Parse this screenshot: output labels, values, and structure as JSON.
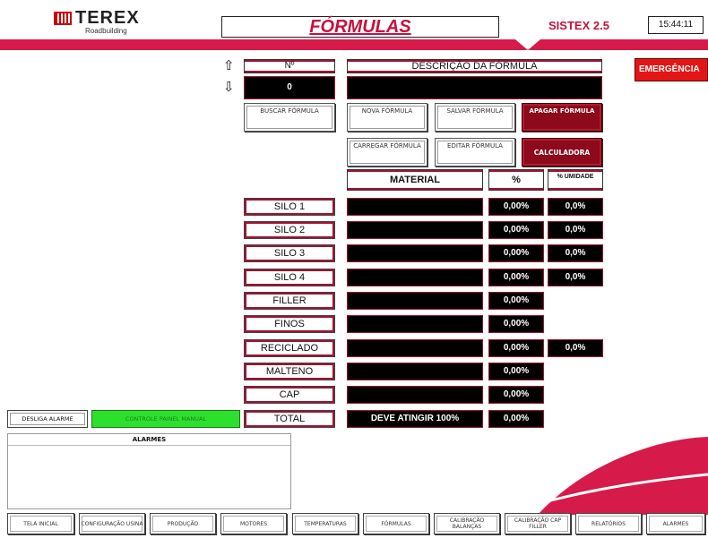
{
  "header": {
    "logo_text": "TEREX",
    "logo_sub": "Roadbuilding",
    "title": "FÓRMULAS",
    "system": "SISTEX  2.5",
    "clock": "15:44:11"
  },
  "emergency_label": "EMERGÊNCIA",
  "formula": {
    "number_header": "Nº",
    "number_value": "0",
    "description_header": "DESCRIÇÃO DA FÓRMULA",
    "description_value": ""
  },
  "buttons": {
    "search": "BUSCAR FÓRMULA",
    "new": "NOVA FÓRMULA",
    "save": "SALVAR FÓRMULA",
    "delete": "APAGAR FÓRMULA",
    "load": "CARREGAR FÓRMULA",
    "edit": "EDITAR FÓRMULA",
    "calculator": "CALCULADORA"
  },
  "table": {
    "col_material": "MATERIAL",
    "col_pct": "%",
    "col_moisture": "% UMIDADE",
    "rows": [
      {
        "label": "SILO 1",
        "pct": "0,00%",
        "moisture": "0,0%"
      },
      {
        "label": "SILO 2",
        "pct": "0,00%",
        "moisture": "0,0%"
      },
      {
        "label": "SILO 3",
        "pct": "0,00%",
        "moisture": "0,0%"
      },
      {
        "label": "SILO 4",
        "pct": "0,00%",
        "moisture": "0,0%"
      },
      {
        "label": "FILLER",
        "pct": "0,00%",
        "moisture": ""
      },
      {
        "label": "FINOS",
        "pct": "0,00%",
        "moisture": ""
      },
      {
        "label": "RECICLADO",
        "pct": "0,00%",
        "moisture": "0,0%"
      },
      {
        "label": "MALTENO",
        "pct": "0,00%",
        "moisture": ""
      },
      {
        "label": "CAP",
        "pct": "0,00%",
        "moisture": ""
      }
    ],
    "total_label": "TOTAL",
    "total_message": "DEVE ATINGIR 100%",
    "total_pct": "0,00%"
  },
  "alarm": {
    "disable_button": "DESLIGA ALARME",
    "control_button": "CONTROLE PAINEL MANUAL",
    "panel_title": "ALARMES"
  },
  "nav": [
    "TELA INICIAL",
    "CONFIGURAÇÃO USINA",
    "PRODUÇÃO",
    "MOTORES",
    "TEMPERATURAS",
    "FÓRMULAS",
    "CALIBRAÇÃO BALANÇAS",
    "CALIBRAÇÃO CAP FILLER",
    "RELATÓRIOS",
    "ALARMES"
  ],
  "colors": {
    "accent_red": "#d61a4a",
    "dark_red_button": "#8c0a1c",
    "emergency": "#e41515",
    "control_green": "#2ee02e"
  }
}
